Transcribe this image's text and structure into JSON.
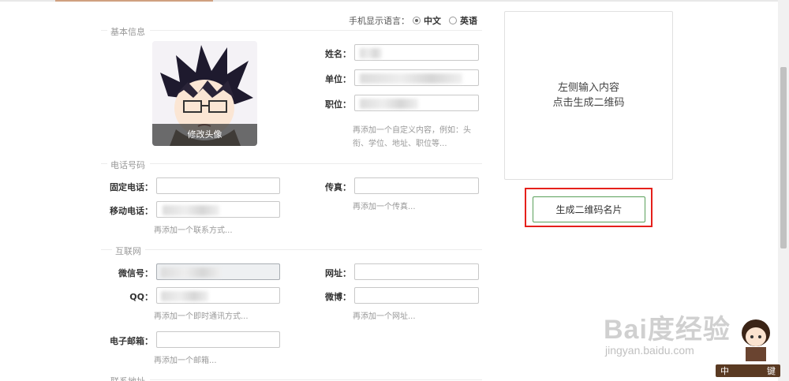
{
  "language": {
    "label": "手机显示语言：",
    "options": [
      {
        "label": "中文",
        "selected": true
      },
      {
        "label": "英语",
        "selected": false
      }
    ]
  },
  "sections": {
    "basic": "基本信息",
    "phone": "电话号码",
    "internet": "互联网",
    "address": "联系地址"
  },
  "avatar": {
    "change_label": "修改头像"
  },
  "basic": {
    "name": {
      "label": "姓名：",
      "value": ""
    },
    "company": {
      "label": "单位：",
      "value": ""
    },
    "position": {
      "label": "职位：",
      "value": ""
    },
    "hint": "再添加一个自定义内容，例如：头衔、学位、地址、职位等..."
  },
  "phone": {
    "landline": {
      "label": "固定电话：",
      "value": ""
    },
    "fax": {
      "label": "传真：",
      "value": ""
    },
    "mobile": {
      "label": "移动电话：",
      "value": ""
    },
    "fax_hint": "再添加一个传真...",
    "contact_hint": "再添加一个联系方式..."
  },
  "internet": {
    "wechat": {
      "label": "微信号：",
      "value": ""
    },
    "website": {
      "label": "网址：",
      "value": ""
    },
    "qq": {
      "label": "QQ：",
      "value": ""
    },
    "weibo": {
      "label": "微博：",
      "value": ""
    },
    "im_hint": "再添加一个即时通讯方式...",
    "url_hint": "再添加一个网址...",
    "email": {
      "label": "电子邮箱：",
      "value": ""
    },
    "email_hint": "再添加一个邮箱..."
  },
  "qr_preview": {
    "line1": "左侧输入内容",
    "line2": "点击生成二维码"
  },
  "generate_button": "生成二维码名片",
  "watermark": {
    "brand": "Bai度经验",
    "site": "jingyan.baidu.com",
    "tag_left": "中",
    "tag_right": "键"
  },
  "colors": {
    "highlight": "#e5201b",
    "button_border": "#5aa05a"
  }
}
